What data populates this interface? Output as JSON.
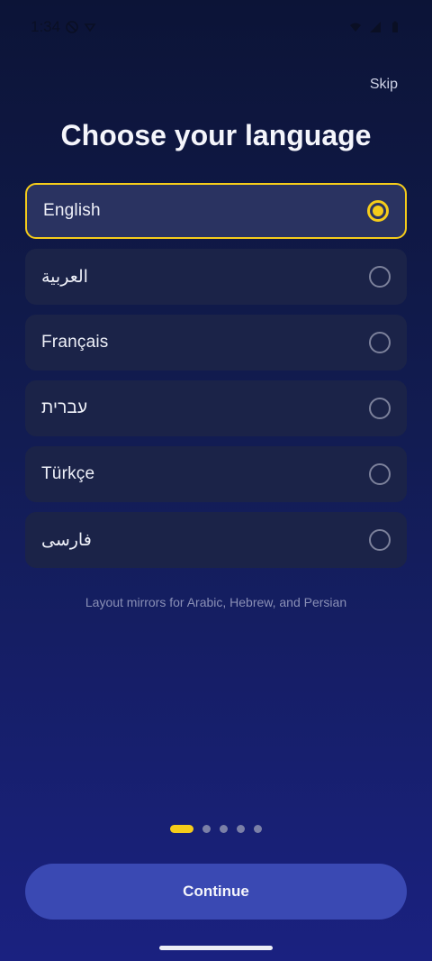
{
  "status_bar": {
    "time": "1:34"
  },
  "header": {
    "skip_label": "Skip",
    "title": "Choose your language"
  },
  "languages": [
    {
      "label": "English",
      "selected": true
    },
    {
      "label": "العربية",
      "selected": false
    },
    {
      "label": "Français",
      "selected": false
    },
    {
      "label": "עברית",
      "selected": false
    },
    {
      "label": "Türkçe",
      "selected": false
    },
    {
      "label": "فارسی",
      "selected": false
    }
  ],
  "note": "Layout mirrors for Arabic, Hebrew, and Persian",
  "pager": {
    "current": 1,
    "total": 5
  },
  "footer": {
    "continue_label": "Continue"
  },
  "colors": {
    "accent": "#f5cc1a",
    "button": "#3a49b3"
  }
}
